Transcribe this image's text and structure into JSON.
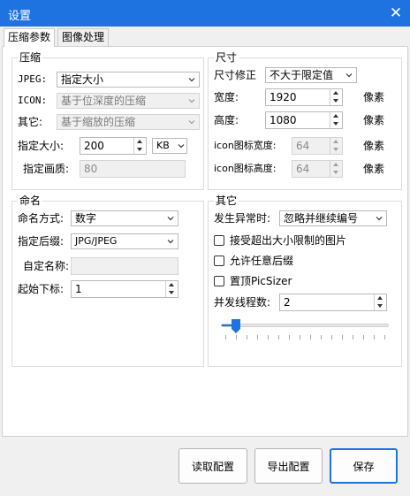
{
  "window": {
    "title": "设置"
  },
  "tabs": [
    {
      "label": "压缩参数",
      "active": true
    },
    {
      "label": "图像处理",
      "active": false
    }
  ],
  "compress": {
    "title": "压缩",
    "jpeg": {
      "label": "JPEG:",
      "value": "指定大小"
    },
    "icon": {
      "label": "ICON:",
      "value": "基于位深度的压缩"
    },
    "other": {
      "label": "其它:",
      "value": "基于缩放的压缩"
    },
    "size": {
      "label": "指定大小:",
      "value": "200",
      "unit": "KB"
    },
    "quality": {
      "label": "指定画质:",
      "value": "80"
    }
  },
  "dimension": {
    "title": "尺寸",
    "fix": {
      "label": "尺寸修正",
      "value": "不大于限定值"
    },
    "width": {
      "label": "宽度:",
      "value": "1920",
      "unit": "像素"
    },
    "height": {
      "label": "高度:",
      "value": "1080",
      "unit": "像素"
    },
    "icon_width": {
      "label": "icon图标宽度:",
      "value": "64",
      "unit": "像素"
    },
    "icon_height": {
      "label": "icon图标高度:",
      "value": "64",
      "unit": "像素"
    }
  },
  "naming": {
    "title": "命名",
    "mode": {
      "label": "命名方式:",
      "value": "数字"
    },
    "suffix": {
      "label": "指定后缀:",
      "value": "JPG/JPEG"
    },
    "custom": {
      "label": "自定名称:",
      "value": ""
    },
    "start": {
      "label": "起始下标:",
      "value": "1"
    }
  },
  "other": {
    "title": "其它",
    "on_error": {
      "label": "发生异常时:",
      "value": "忽略并继续编号"
    },
    "checks": [
      {
        "label": "接受超出大小限制的图片",
        "checked": false
      },
      {
        "label": "允许任意后缀",
        "checked": false
      },
      {
        "label": "置顶PicSizer",
        "checked": false
      }
    ],
    "threads": {
      "label": "并发线程数:",
      "value": "2"
    },
    "slider": {
      "min": 1,
      "max": 16,
      "value": 2
    }
  },
  "buttons": {
    "read": "读取配置",
    "export": "导出配置",
    "save": "保存"
  },
  "colors": {
    "accent": "#1f73e0"
  }
}
